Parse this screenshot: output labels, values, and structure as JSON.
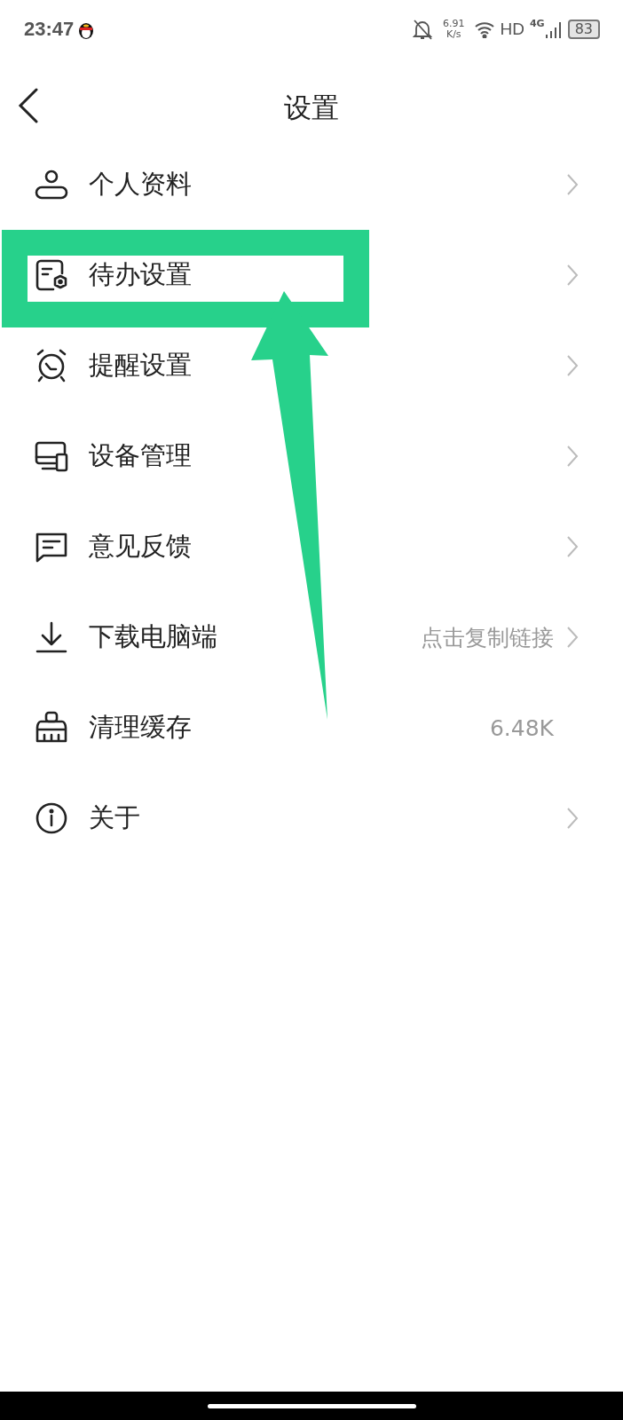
{
  "status_bar": {
    "time": "23:47",
    "speed": "6.91",
    "speed_unit": "K/s",
    "network": "HD",
    "cell": "4G",
    "battery": "83"
  },
  "header": {
    "title": "设置"
  },
  "items": [
    {
      "label": "个人资料",
      "chevron": true,
      "highlighted": false
    },
    {
      "label": "待办设置",
      "chevron": true,
      "highlighted": true
    },
    {
      "label": "提醒设置",
      "chevron": true,
      "highlighted": false
    },
    {
      "label": "设备管理",
      "chevron": true,
      "highlighted": false
    },
    {
      "label": "意见反馈",
      "chevron": true,
      "highlighted": false
    },
    {
      "label": "下载电脑端",
      "value": "点击复制链接",
      "chevron": true,
      "highlighted": false
    },
    {
      "label": "清理缓存",
      "value": "6.48K",
      "chevron": false,
      "highlighted": false
    },
    {
      "label": "关于",
      "chevron": true,
      "highlighted": false
    }
  ]
}
